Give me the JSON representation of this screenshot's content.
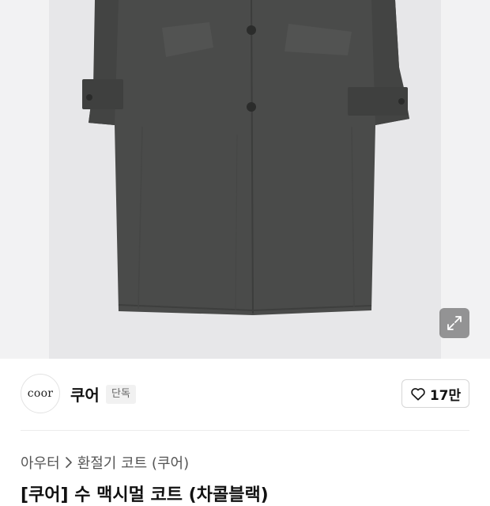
{
  "product_image": {
    "alt": "",
    "expand_icon": "expand-icon"
  },
  "brand": {
    "logo_text": "coor",
    "name": "쿠어",
    "badge": "단독"
  },
  "like": {
    "icon": "heart-icon",
    "count": "17만"
  },
  "breadcrumb": {
    "items": [
      "아우터",
      "환절기 코트 (쿠어)"
    ],
    "separator_icon": "chevron-right-icon"
  },
  "product_title": "[쿠어] 수 맥시멀 코트 (차콜블랙)",
  "colors": {
    "coat": "#4a4b4a",
    "panel_bg": "#e7e7e9",
    "page_bg": "#f2f2f3"
  }
}
